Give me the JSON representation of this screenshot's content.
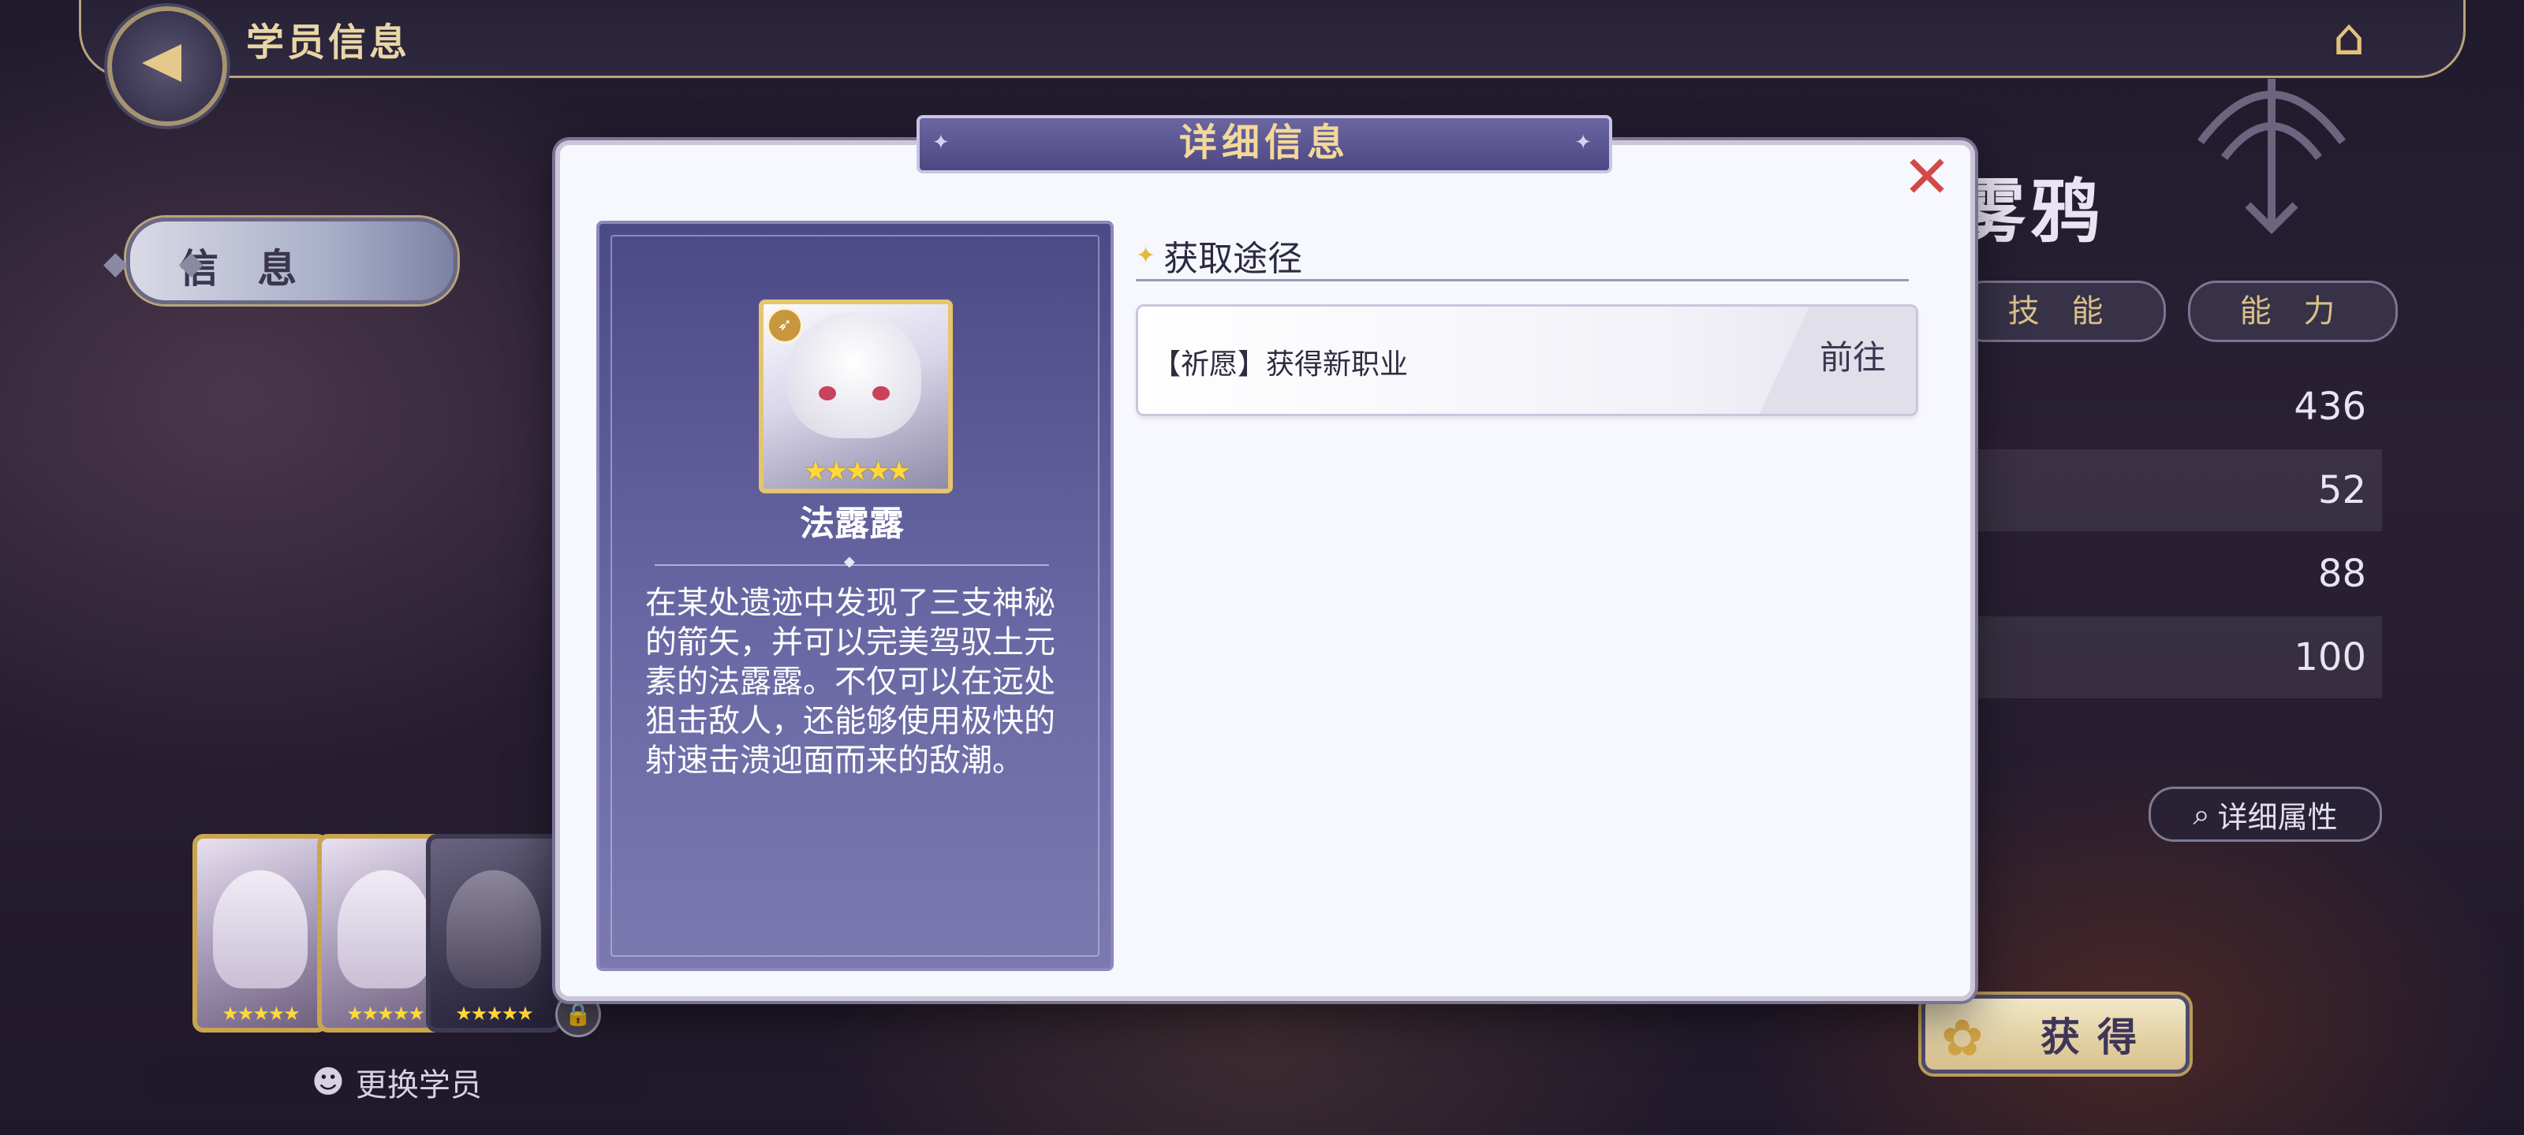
{
  "header": {
    "title": "学员信息"
  },
  "left": {
    "tab_info": "信 息",
    "switch_label": "更换学员"
  },
  "character": {
    "name_large": "雾鸦",
    "stats": [
      "436",
      "52",
      "88",
      "100"
    ],
    "tabs": [
      "技 能",
      "能 力"
    ],
    "detail_attr_label": "详细属性",
    "obtain_label": "获得"
  },
  "modal": {
    "title": "详细信息",
    "char_name": "法露露",
    "description": "在某处遗迹中发现了三支神秘的箭矢，并可以完美驾驭土元素的法露露。不仅可以在远处狙击敌人，还能够使用极快的射速击溃迎面而来的敌潮。",
    "stars": "★★★★★",
    "section_title": "获取途径",
    "routes": [
      {
        "label": "【祈愿】获得新职业",
        "go": "前往"
      }
    ]
  },
  "icons": {
    "back": "back-arrow-icon",
    "home": "home-icon",
    "close": "close-icon",
    "search": "search-icon",
    "skull": "student-icon",
    "lock": "lock-icon"
  },
  "colors": {
    "accent_gold": "#e6c56c",
    "panel_purple": "#4b4a86",
    "close_red": "#d34848"
  }
}
